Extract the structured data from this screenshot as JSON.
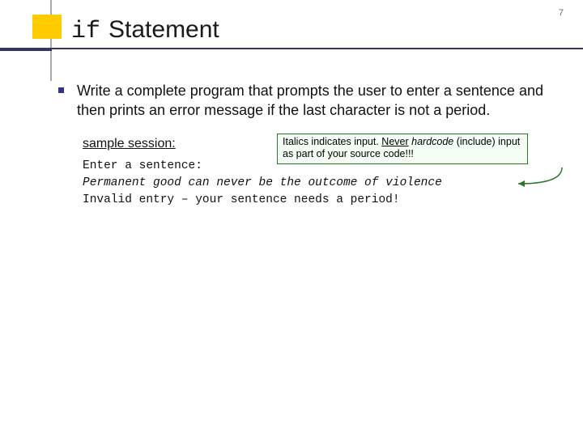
{
  "pageNumber": "7",
  "title": {
    "ifWord": "if",
    "rest": "Statement"
  },
  "bulletText": "Write a complete program that prompts the user to enter a sentence and then prints an error message if the last character is not a period.",
  "sampleLabel": "sample session:",
  "callout": {
    "lead": "Italics indicates input. ",
    "never": "Never",
    "space": " ",
    "hardcode": "hardcode",
    "tail": " (include) input as part of your source code!!!"
  },
  "code": {
    "line1": "Enter a sentence:",
    "line2": "Permanent good can never be the outcome of violence",
    "line3": "Invalid entry – your sentence needs a period!"
  }
}
